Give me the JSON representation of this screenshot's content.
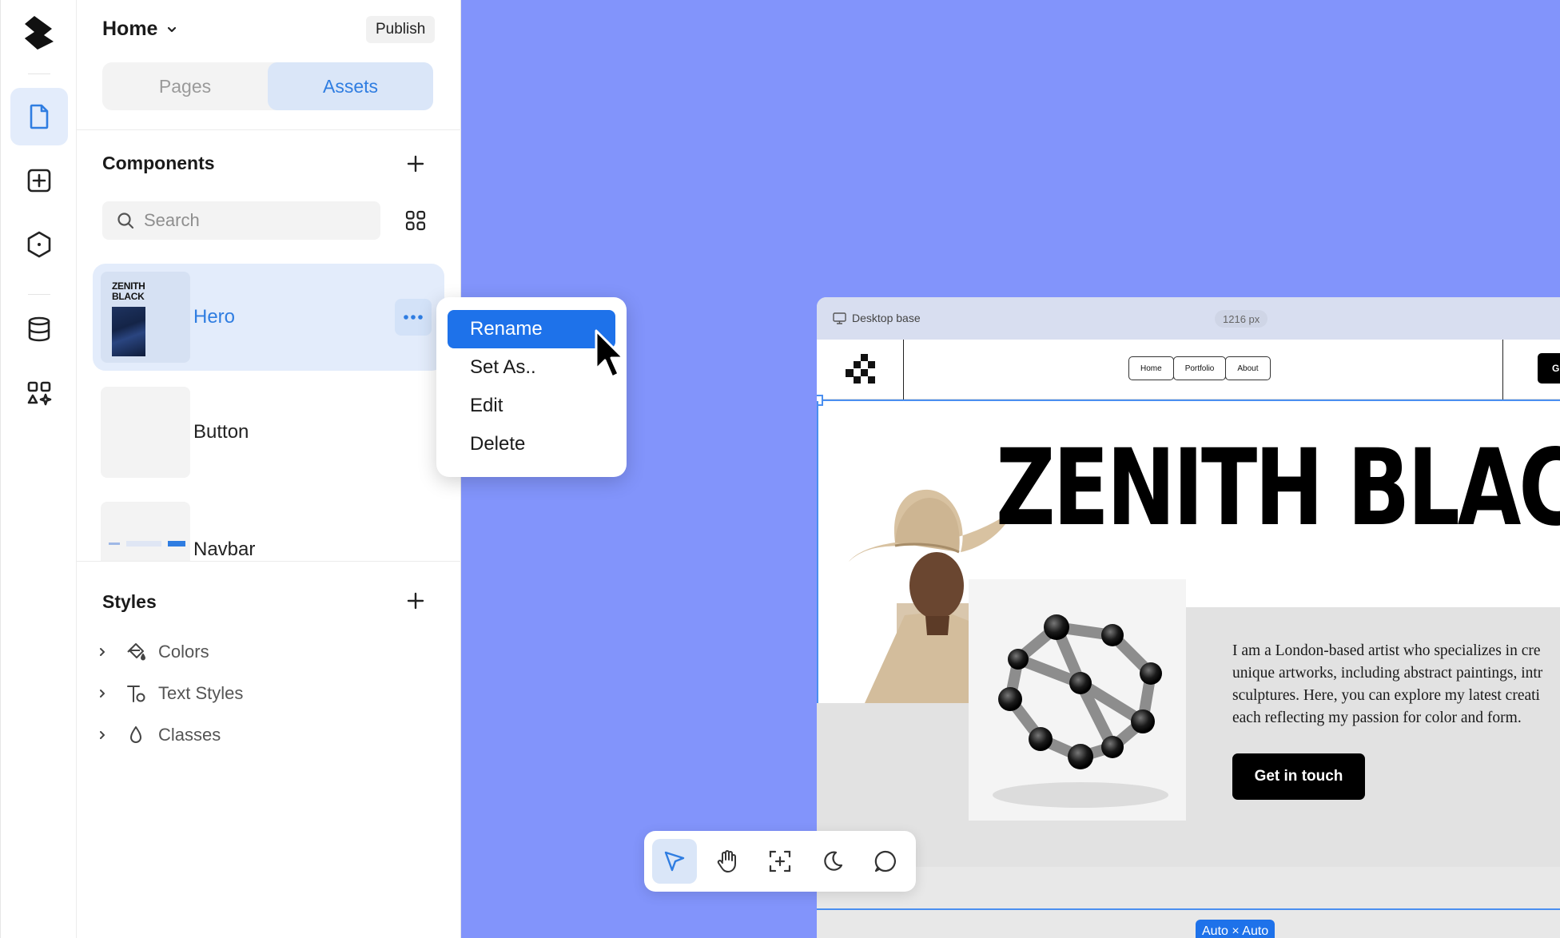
{
  "app": {
    "page_selector": "Home",
    "publish_label": "Publish"
  },
  "tabs": [
    {
      "label": "Pages",
      "active": false
    },
    {
      "label": "Assets",
      "active": true
    }
  ],
  "components": {
    "title": "Components",
    "search_placeholder": "Search",
    "items": [
      {
        "label": "Hero",
        "selected": true,
        "thumb_title": "ZENITH BLACK"
      },
      {
        "label": "Button",
        "selected": false
      },
      {
        "label": "Navbar",
        "selected": false
      }
    ]
  },
  "context_menu": {
    "items": [
      {
        "label": "Rename",
        "active": true
      },
      {
        "label": "Set As.."
      },
      {
        "label": "Edit"
      },
      {
        "label": "Delete"
      }
    ]
  },
  "styles": {
    "title": "Styles",
    "items": [
      {
        "label": "Colors",
        "icon": "paint-bucket-icon"
      },
      {
        "label": "Text Styles",
        "icon": "text-style-icon"
      },
      {
        "label": "Classes",
        "icon": "drop-icon"
      }
    ]
  },
  "frame": {
    "label": "Desktop base",
    "width_label": "1216 px",
    "size_badge": "Auto × Auto"
  },
  "site": {
    "nav_links": [
      "Home",
      "Portfolio",
      "About"
    ],
    "nav_cta": "G",
    "hero_title": "ZENITH BLAC",
    "hero_text_lines": [
      "I am a London-based artist who specializes in cre",
      "unique artworks, including abstract paintings, intr",
      "sculptures. Here, you can explore my latest creati",
      "each reflecting my passion for color and form."
    ],
    "cta_label": "Get in touch"
  },
  "colors": {
    "canvas": "#8294fb",
    "accent": "#1e72ea",
    "selected_bg": "#e3ecfb"
  },
  "toolbar": {
    "tools": [
      "pointer-icon",
      "hand-icon",
      "frame-add-icon",
      "moon-icon",
      "comment-icon"
    ],
    "active_tool": "pointer-icon"
  }
}
